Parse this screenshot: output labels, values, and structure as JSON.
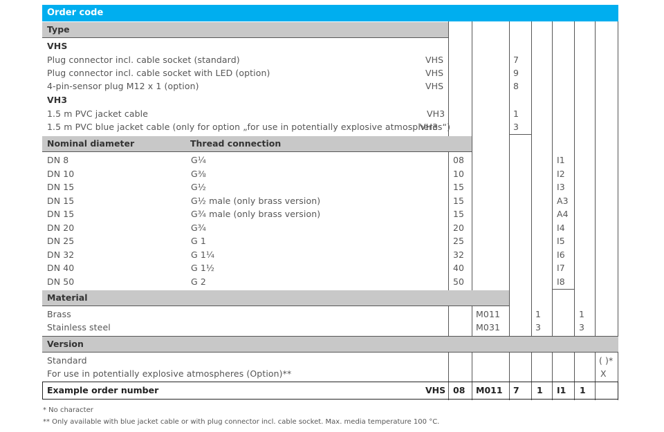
{
  "title": "Order code",
  "type_section": {
    "header": "Type",
    "group1": "VHS",
    "rows1": [
      {
        "label": "Plug connector incl. cable socket (standard)",
        "code": "VHS",
        "value": "7"
      },
      {
        "label": "Plug connector incl. cable socket with LED (option)",
        "code": "VHS",
        "value": "9"
      },
      {
        "label": "4-pin-sensor plug M12 x 1 (option)",
        "code": "VHS",
        "value": "8"
      }
    ],
    "group2": "VH3",
    "rows2": [
      {
        "label": "1.5 m PVC jacket cable",
        "code": "VH3",
        "value": "1"
      },
      {
        "label": "1.5 m PVC blue jacket cable (only for option „for use in potentially explosive atmospheres“)",
        "code": "VH3",
        "value": "3"
      }
    ]
  },
  "diameter_section": {
    "header_col1": "Nominal diameter",
    "header_col2": "Thread connection",
    "rows": [
      {
        "dn": "DN 8",
        "thread": "G¼",
        "code": "08",
        "value": "I1"
      },
      {
        "dn": "DN 10",
        "thread": "G⅜",
        "code": "10",
        "value": "I2"
      },
      {
        "dn": "DN 15",
        "thread": "G½",
        "code": "15",
        "value": "I3"
      },
      {
        "dn": "DN 15",
        "thread": "G½ male (only brass version)",
        "code": "15",
        "value": "A3"
      },
      {
        "dn": "DN 15",
        "thread": "G¾ male (only brass version)",
        "code": "15",
        "value": "A4"
      },
      {
        "dn": "DN 20",
        "thread": "G¾",
        "code": "20",
        "value": "I4"
      },
      {
        "dn": "DN 25",
        "thread": "G 1",
        "code": "25",
        "value": "I5"
      },
      {
        "dn": "DN 32",
        "thread": "G 1¼",
        "code": "32",
        "value": "I6"
      },
      {
        "dn": "DN 40",
        "thread": "G 1½",
        "code": "40",
        "value": "I7"
      },
      {
        "dn": "DN 50",
        "thread": "G 2",
        "code": "50",
        "value": "I8"
      }
    ]
  },
  "material_section": {
    "header": "Material",
    "rows": [
      {
        "label": "Brass",
        "code": "M011",
        "value_a": "1",
        "value_b": "1"
      },
      {
        "label": "Stainless steel",
        "code": "M031",
        "value_a": "3",
        "value_b": "3"
      }
    ]
  },
  "version_section": {
    "header": "Version",
    "rows": [
      {
        "label": "Standard",
        "value": "( )*"
      },
      {
        "label": "For use in potentially explosive atmospheres (Option)**",
        "value": "X"
      }
    ]
  },
  "example": {
    "label": "Example order number",
    "cells": [
      "VHS",
      "08",
      "M011",
      "7",
      "1",
      "I1",
      "1",
      ""
    ]
  },
  "footnotes": [
    "*   No character",
    "** Only available with blue jacket cable or with plug connector incl. cable socket. Max. media temperature 100 °C."
  ],
  "colors": {
    "title_bar": "#00aeef",
    "section_header": "#c8c8c8",
    "rule": "#555555"
  }
}
